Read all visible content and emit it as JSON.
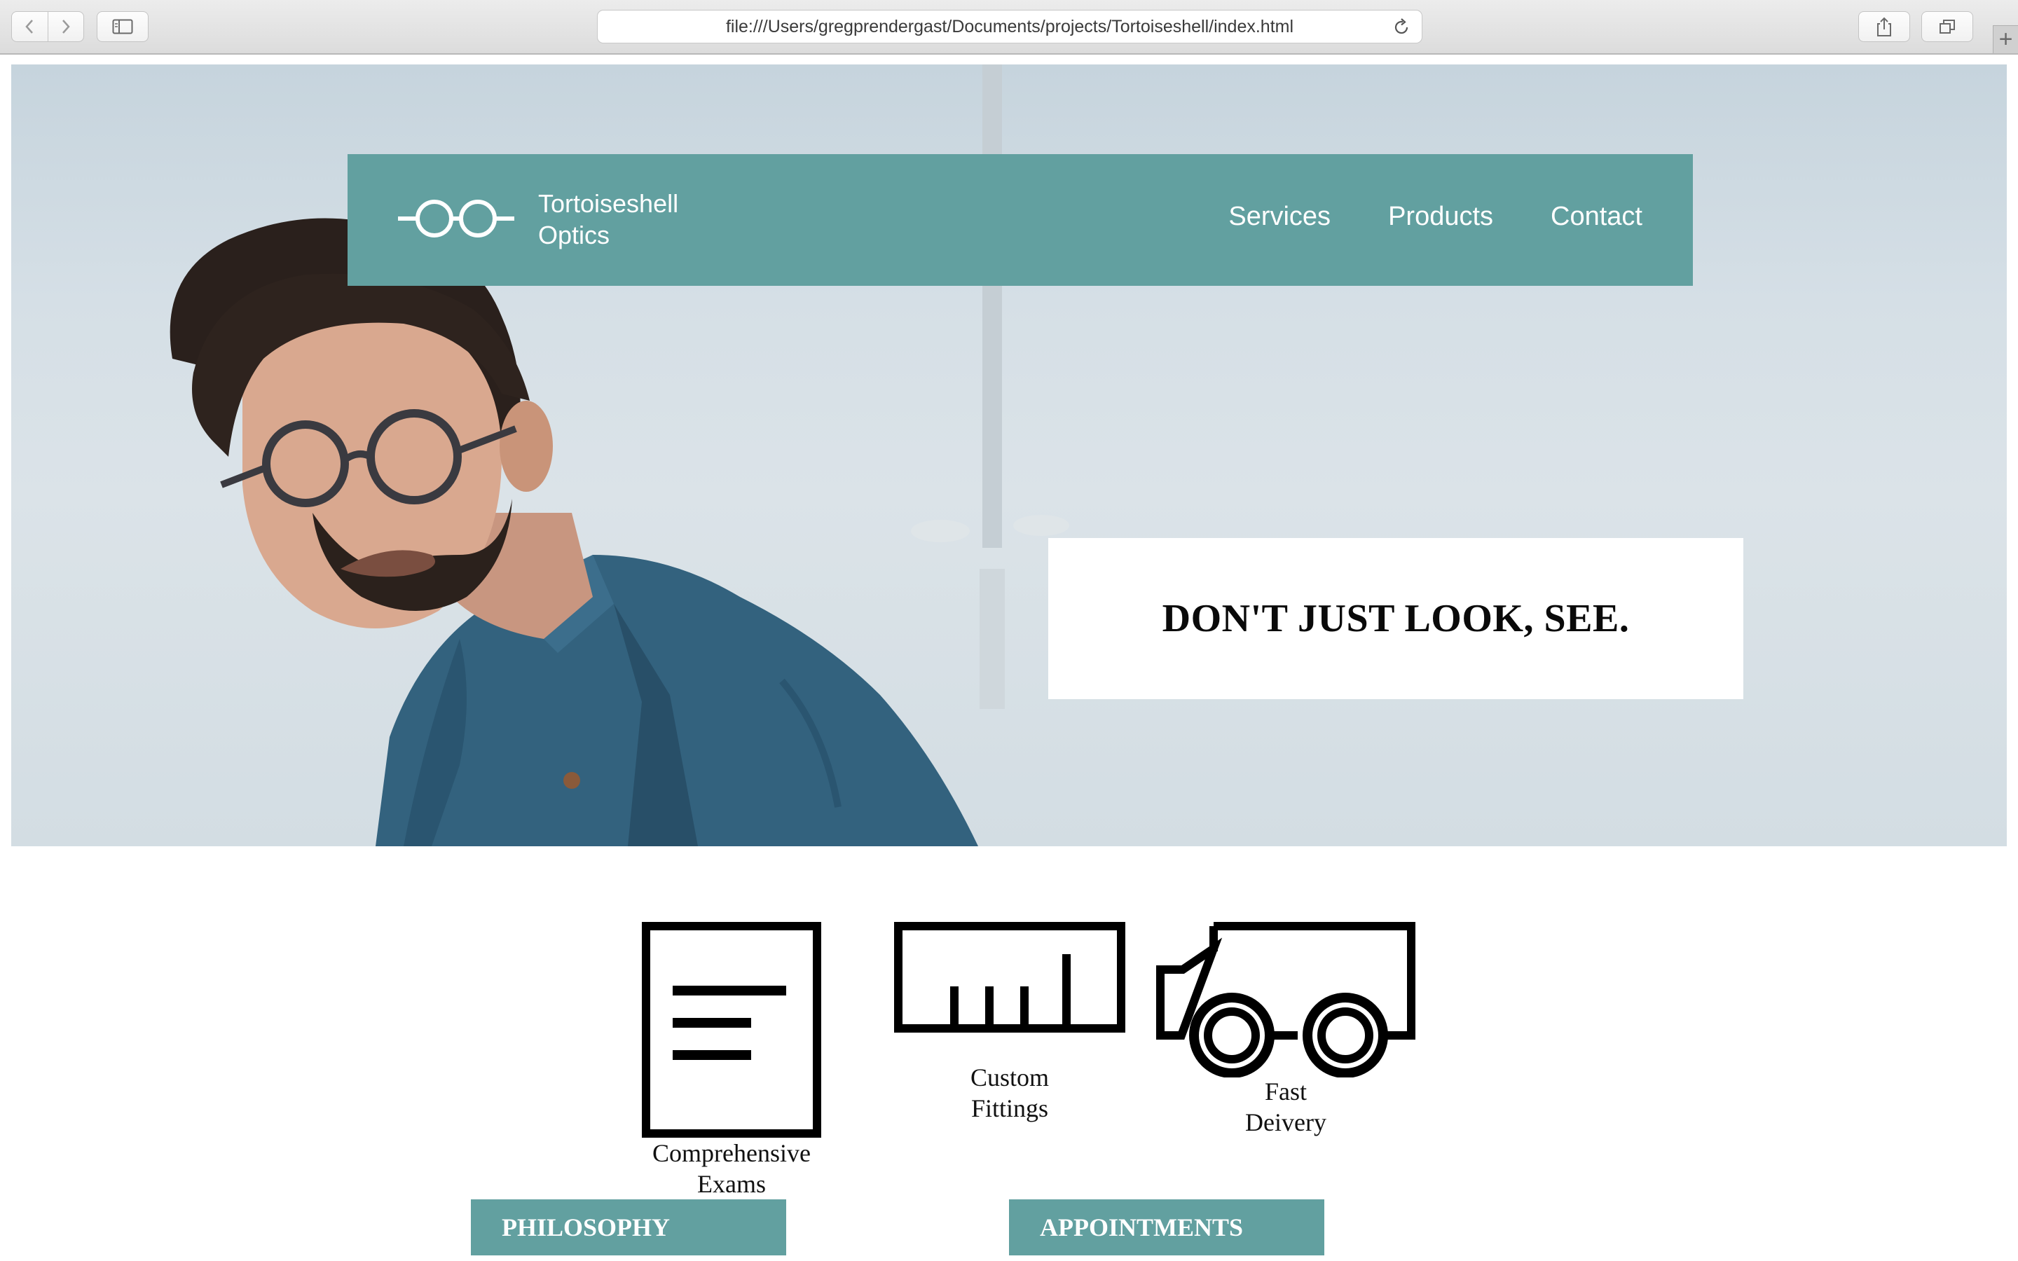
{
  "browser": {
    "url": "file:///Users/gregprendergast/Documents/projects/Tortoiseshell/index.html"
  },
  "site": {
    "logo_line1": "Tortoiseshell",
    "logo_line2": "Optics",
    "nav": [
      "Services",
      "Products",
      "Contact"
    ],
    "tagline": "DON'T JUST LOOK, SEE.",
    "accent_color": "#62a0a0"
  },
  "services": [
    {
      "line1": "Comprehensive",
      "line2": "Exams",
      "icon": "document-icon"
    },
    {
      "line1": "Custom",
      "line2": "Fittings",
      "icon": "ruler-icon"
    },
    {
      "line1": "Fast",
      "line2": "Deivery",
      "icon": "truck-icon"
    }
  ],
  "buttons": {
    "philosophy": "PHILOSOPHY",
    "appointments": "APPOINTMENTS"
  }
}
